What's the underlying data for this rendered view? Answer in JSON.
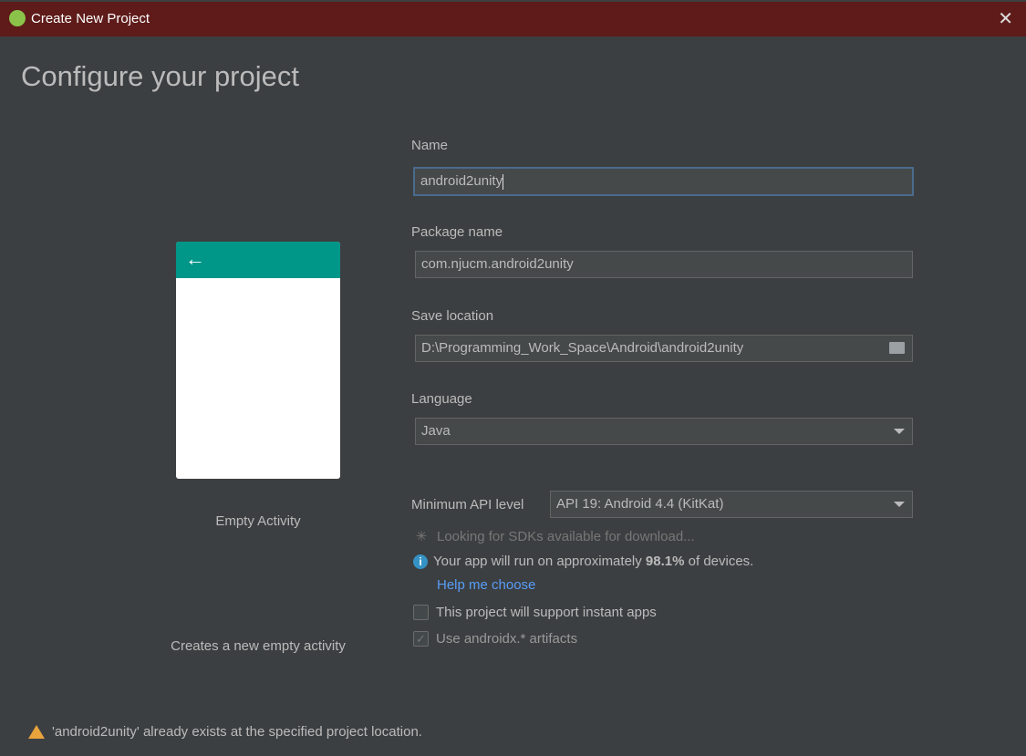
{
  "window": {
    "title": "Create New Project",
    "close_icon": "close-icon"
  },
  "heading": "Configure your project",
  "template": {
    "name": "Empty Activity",
    "description": "Creates a new empty activity",
    "colors": {
      "app_bar": "#009688"
    }
  },
  "form": {
    "name": {
      "label": "Name",
      "value": "android2unity"
    },
    "package": {
      "label": "Package name",
      "value": "com.njucm.android2unity"
    },
    "location": {
      "label": "Save location",
      "value": "D:\\Programming_Work_Space\\Android\\android2unity"
    },
    "language": {
      "label": "Language",
      "value": "Java"
    },
    "min_api": {
      "label": "Minimum API level",
      "value": "API 19: Android 4.4 (KitKat)"
    },
    "sdk_status": "Looking for SDKs available for download...",
    "coverage": {
      "prefix": "Your app will run on approximately ",
      "percent": "98.1%",
      "suffix": " of devices."
    },
    "help_link": "Help me choose",
    "instant_apps": {
      "label": "This project will support instant apps",
      "checked": false
    },
    "androidx": {
      "label": "Use androidx.* artifacts",
      "checked": true,
      "disabled": true
    }
  },
  "warning": "'android2unity' already exists at the specified project location."
}
